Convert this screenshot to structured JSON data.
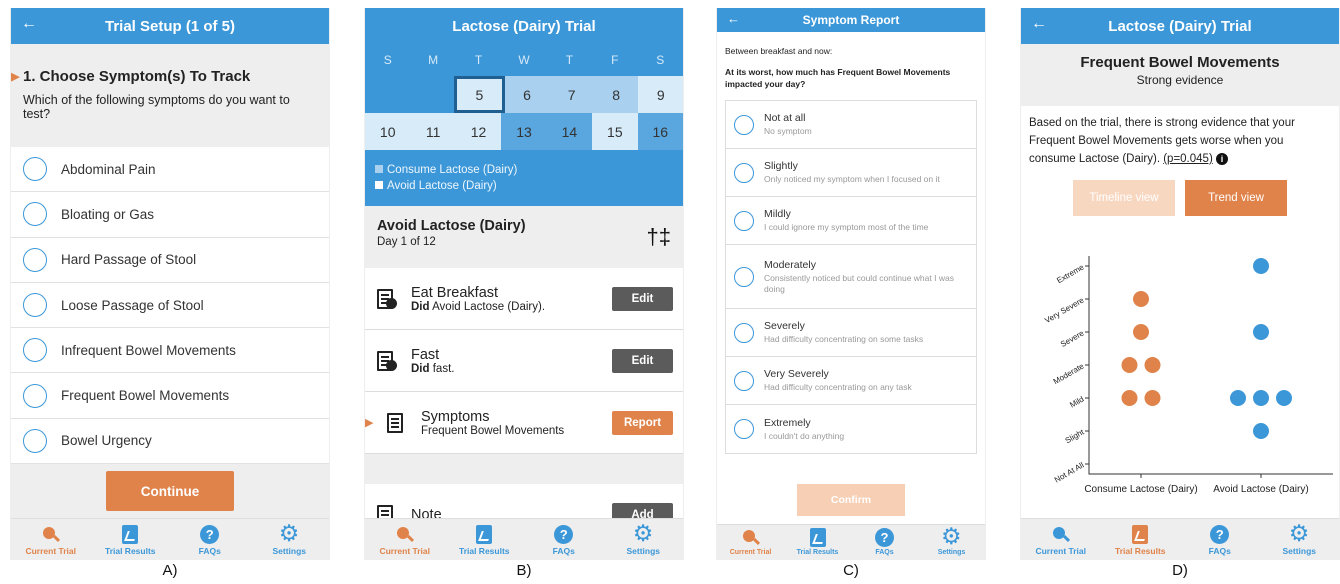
{
  "panel_labels": [
    "A)",
    "B)",
    "C)",
    "D)"
  ],
  "tabbar": {
    "current_trial": "Current Trial",
    "trial_results": "Trial Results",
    "faqs": "FAQs",
    "faq_glyph": "?",
    "settings": "Settings"
  },
  "panelA": {
    "title": "Trial Setup (1 of 5)",
    "back_icon": "←",
    "question": "1. Choose Symptom(s) To Track",
    "question_sub": "Which of the following symptoms do you want to test?",
    "options": [
      "Abdominal Pain",
      "Bloating or Gas",
      "Hard Passage of Stool",
      "Loose Passage of Stool",
      "Infrequent Bowel Movements",
      "Frequent Bowel Movements",
      "Bowel Urgency"
    ],
    "continue": "Continue"
  },
  "panelB": {
    "title": "Lactose (Dairy) Trial",
    "weekdays": [
      "S",
      "M",
      "T",
      "W",
      "T",
      "F",
      "S"
    ],
    "week1": [
      "",
      "",
      "5",
      "6",
      "7",
      "8",
      "9"
    ],
    "week2": [
      "10",
      "11",
      "12",
      "13",
      "14",
      "15",
      "16"
    ],
    "legend_consume": "Consume Lactose (Dairy)",
    "legend_avoid": "Avoid Lactose (Dairy)",
    "day_title": "Avoid Lactose (Dairy)",
    "day_sub": "Day 1 of 12",
    "cutlery_icon": "†‡",
    "rows": {
      "breakfast_title": "Eat Breakfast",
      "breakfast_did": "Did",
      "breakfast_desc": " Avoid Lactose (Dairy).",
      "breakfast_btn": "Edit",
      "fast_title": "Fast",
      "fast_did": "Did",
      "fast_desc": " fast.",
      "fast_btn": "Edit",
      "symptoms_title": "Symptoms",
      "symptoms_desc": "Frequent Bowel Movements",
      "symptoms_btn": "Report",
      "note_title": "Note",
      "note_btn": "Add"
    }
  },
  "panelC": {
    "title": "Symptom Report",
    "intro": "Between breakfast and now:",
    "question": "At its worst, how much has Frequent Bowel Movements impacted your day?",
    "options": [
      {
        "label": "Not at all",
        "desc": "No symptom"
      },
      {
        "label": "Slightly",
        "desc": "Only noticed my symptom when I focused on it"
      },
      {
        "label": "Mildly",
        "desc": "I could ignore my symptom most of the time"
      },
      {
        "label": "Moderately",
        "desc": "Consistently noticed but could continue what I was doing"
      },
      {
        "label": "Severely",
        "desc": "Had difficulty concentrating on some tasks"
      },
      {
        "label": "Very Severely",
        "desc": "Had difficulty concentrating on any task"
      },
      {
        "label": "Extremely",
        "desc": "I couldn't do anything"
      }
    ],
    "confirm": "Confirm"
  },
  "panelD": {
    "title": "Lactose (Dairy) Trial",
    "heading": "Frequent Bowel Movements",
    "evidence": "Strong evidence",
    "text_pre": "Based on the trial, there is strong evidence that your Frequent Bowel Movements gets worse when you consume Lactose (Dairy). ",
    "pvalue": "(p=0.045)",
    "info_glyph": "i",
    "timeline_btn": "Timeline view",
    "trend_btn": "Trend view"
  },
  "chart_data": {
    "type": "scatter",
    "categories": [
      "Consume Lactose (Dairy)",
      "Avoid Lactose (Dairy)"
    ],
    "y_levels": [
      "Not At All",
      "Slight",
      "Mild",
      "Moderate",
      "Severe",
      "Very Severe",
      "Extreme"
    ],
    "series": [
      {
        "category": "Consume Lactose (Dairy)",
        "color": "#e0834a",
        "values": [
          2,
          2,
          3,
          3,
          4,
          5
        ]
      },
      {
        "category": "Avoid Lactose (Dairy)",
        "color": "#3b97d8",
        "values": [
          1,
          2,
          2,
          2,
          4,
          6
        ]
      }
    ]
  },
  "colors": {
    "accent_blue": "#3b97d8",
    "accent_orange": "#e0834a"
  }
}
